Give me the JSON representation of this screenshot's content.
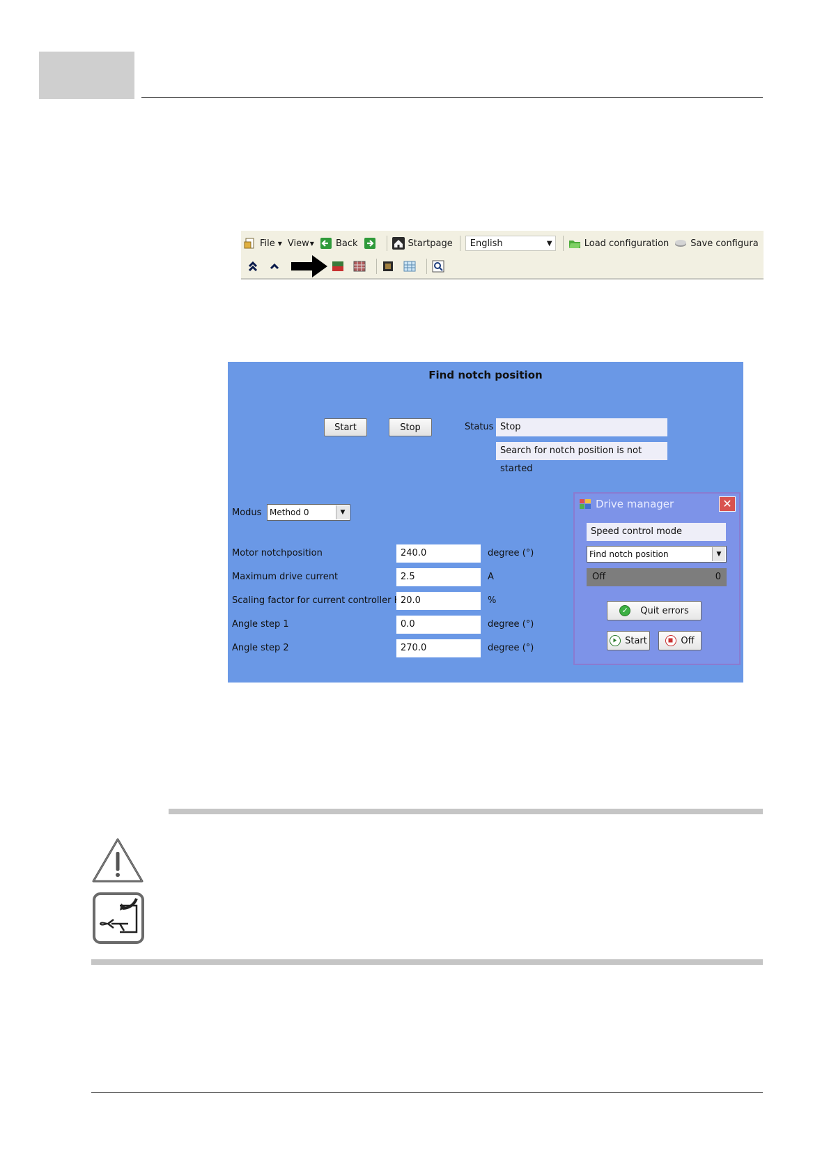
{
  "toolbar": {
    "file_label": "File",
    "view_label": "View",
    "back_label": "Back",
    "startpage_label": "Startpage",
    "language_value": "English",
    "load_label": "Load configuration",
    "save_label": "Save configura"
  },
  "notch": {
    "title": "Find notch position",
    "start_label": "Start",
    "stop_label": "Stop",
    "status_label": "Status",
    "status_value": "Stop",
    "status_message": "Search for notch position is not started",
    "modus_label": "Modus",
    "modus_value": "Method 0",
    "params": [
      {
        "label": "Motor notchposition",
        "value": "240.0",
        "unit": "degree (°)"
      },
      {
        "label": "Maximum drive current",
        "value": "2.5",
        "unit": "A"
      },
      {
        "label": "Scaling factor for current controller Kp",
        "value": "20.0",
        "unit": "%"
      },
      {
        "label": "Angle step 1",
        "value": "0.0",
        "unit": "degree (°)"
      },
      {
        "label": "Angle step 2",
        "value": "270.0",
        "unit": "degree (°)"
      }
    ]
  },
  "drive_manager": {
    "title": "Drive manager",
    "mode": "Speed control mode",
    "function_value": "Find notch position",
    "state_text": "Off",
    "state_value": "0",
    "quit_label": "Quit errors",
    "start_label": "Start",
    "off_label": "Off"
  },
  "colors": {
    "panel_bg": "#6a98e6",
    "drive_manager_bg": "#7d93e8",
    "close_button": "#d9534f",
    "toolbar_bg": "#f2f0e2"
  },
  "icons": {
    "warning": "warning-triangle-icon",
    "exit": "exit-arrow-icon",
    "pointer": "arrow-right-icon"
  }
}
